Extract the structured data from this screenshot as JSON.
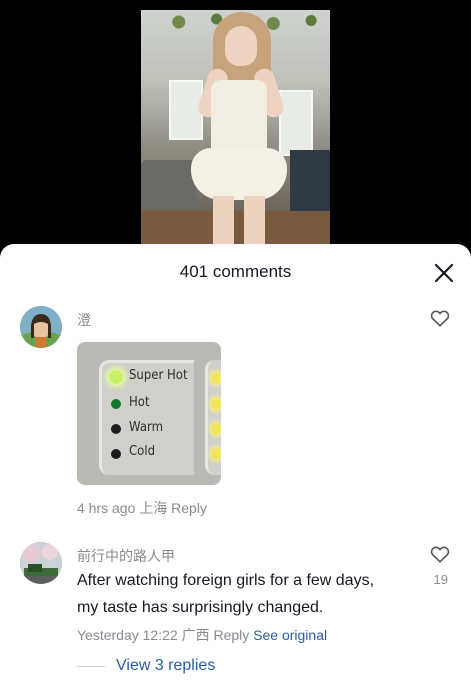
{
  "comments_panel": {
    "title": "401 comments",
    "close_icon": "close-icon"
  },
  "comments": [
    {
      "username": "澄",
      "image_text": {
        "rows": [
          "Super Hot",
          "Hot",
          "Warm",
          "Cold"
        ]
      },
      "time": "4 hrs ago",
      "location": "上海",
      "reply_label": "Reply",
      "like_icon": "heart-outline-icon"
    },
    {
      "username": "前行中的路人甲",
      "text_line1": "After watching foreign girls for a few days,",
      "text_line2": "my taste has surprisingly changed.",
      "like_count": "19",
      "time": "Yesterday 12:22",
      "location": "广西",
      "reply_label": "Reply",
      "see_original_label": "See original",
      "view_replies_label": "View 3 replies",
      "like_icon": "heart-outline-icon"
    }
  ],
  "colors": {
    "link": "#2b5d9e",
    "muted": "#8a8b91",
    "text": "#161823",
    "sheet_bg": "#ffffff",
    "backdrop": "#000000"
  }
}
